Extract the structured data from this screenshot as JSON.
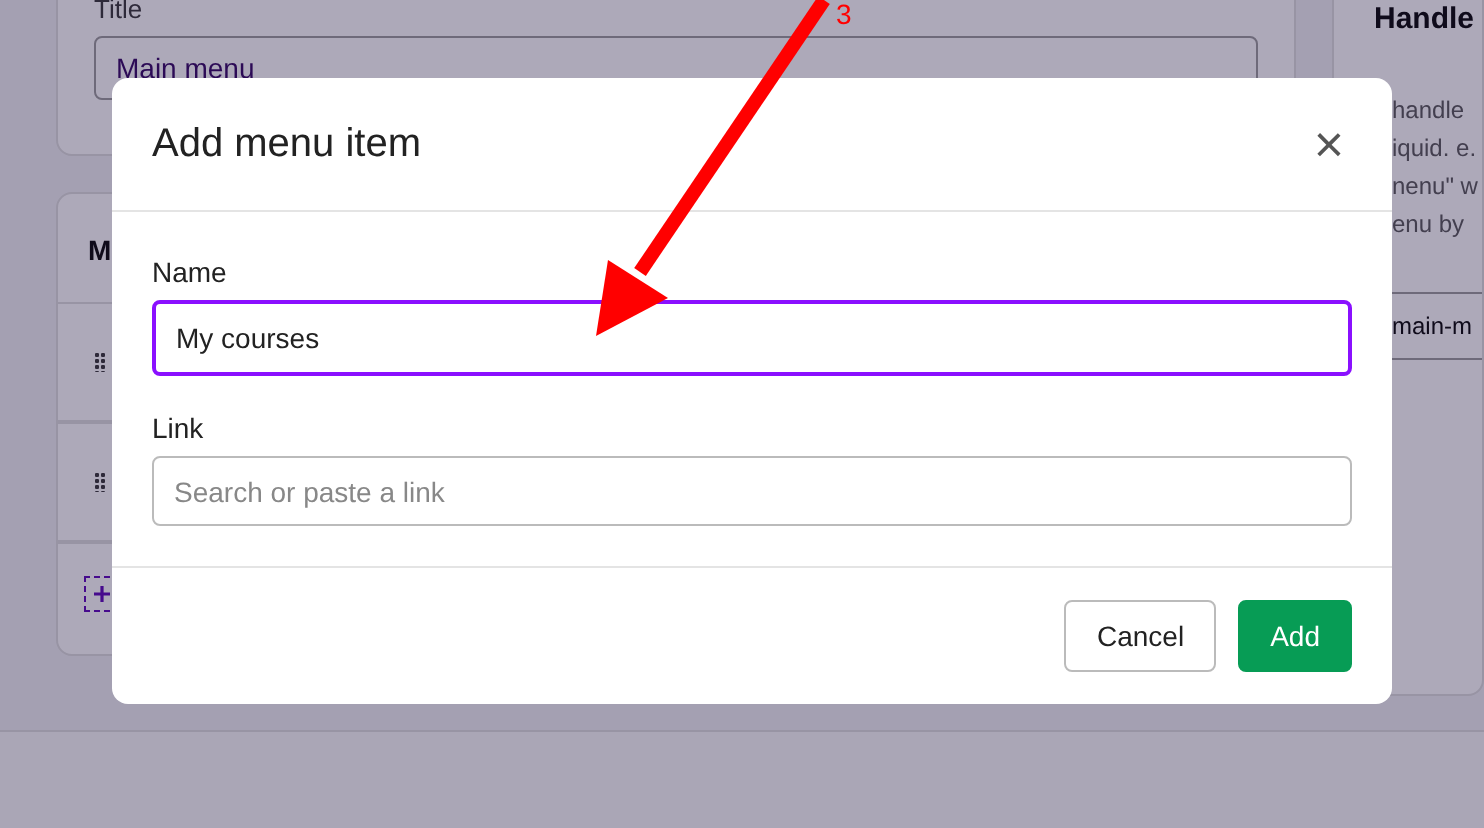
{
  "background": {
    "title_card": {
      "label": "Title",
      "value": "Main menu"
    },
    "items_card": {
      "heading": "M"
    },
    "handle_card": {
      "heading": "Handle",
      "lines": [
        "handle",
        "iquid. e.",
        "nenu\" w",
        "enu by"
      ],
      "value": "main-m"
    }
  },
  "annotation": {
    "number": "3"
  },
  "dialog": {
    "title": "Add menu item",
    "close": "×",
    "fields": [
      {
        "label": "Name",
        "value": "My courses",
        "focused": true
      },
      {
        "label": "Link",
        "placeholder": "Search or paste a link",
        "focused": false
      }
    ],
    "buttons": [
      {
        "label": "Cancel",
        "kind": "secondary"
      },
      {
        "label": "Add",
        "kind": "primary"
      }
    ]
  }
}
